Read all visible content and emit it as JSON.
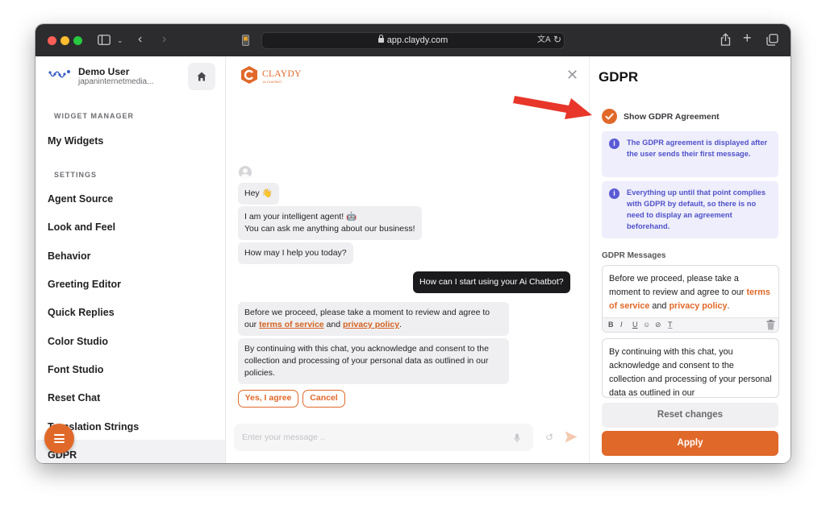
{
  "browser": {
    "url": "app.claydy.com"
  },
  "sidebar": {
    "user_name": "Demo User",
    "user_email": "japaninternetmedia...",
    "section_widget": "WIDGET MANAGER",
    "widget_items": [
      {
        "label": "My Widgets"
      }
    ],
    "section_settings": "SETTINGS",
    "settings_items": [
      {
        "label": "Agent Source"
      },
      {
        "label": "Look and Feel"
      },
      {
        "label": "Behavior"
      },
      {
        "label": "Greeting Editor"
      },
      {
        "label": "Quick Replies"
      },
      {
        "label": "Color Studio"
      },
      {
        "label": "Font Studio"
      },
      {
        "label": "Reset Chat"
      },
      {
        "label": "Translation Strings"
      },
      {
        "label": "GDPR"
      }
    ]
  },
  "chat": {
    "brand_name": "CLAYDY",
    "brand_sub": "AI CHATBOT",
    "messages": [
      {
        "text": "Hey 👋"
      },
      {
        "line1": "I am your intelligent agent! 🤖",
        "line2": "You can ask me anything about our business!"
      },
      {
        "text": "How may I help you today?"
      },
      {
        "text": "How can I start using your Ai Chatbot?"
      },
      {
        "pre": "Before we proceed, please take a moment to review and agree to our ",
        "link1": "terms of service",
        "mid": " and ",
        "link2": "privacy policy",
        "post": "."
      },
      {
        "text": "By continuing with this chat, you acknowledge and consent to the collection and processing of your personal data as outlined in our policies."
      }
    ],
    "agree_label": "Yes, I agree",
    "cancel_label": "Cancel",
    "input_placeholder": "Enter your message .."
  },
  "panel": {
    "title": "GDPR",
    "show_agreement_label": "Show GDPR Agreement",
    "show_agreement_checked": true,
    "info1": "The GDPR agreement is displayed after the user sends their first message.",
    "info2": "Everything up until that point complies with GDPR by default, so there is no need to display an agreement beforehand.",
    "messages_label": "GDPR Messages",
    "message1": {
      "pre": "Before we proceed, please take a moment to review and agree to our ",
      "link1": "terms of service",
      "mid": " and ",
      "link2": "privacy policy",
      "post": "."
    },
    "message2": "By continuing with this chat, you acknowledge and consent to the collection and processing of your personal data as outlined in our",
    "toolbar": {
      "bold": "B",
      "italic": "I",
      "underline": "U",
      "emoji": "☺",
      "link": "⊘",
      "clear": "T̲"
    },
    "reset_label": "Reset changes",
    "apply_label": "Apply"
  },
  "colors": {
    "accent": "#e0692a",
    "info_bg": "#eeeefc",
    "info_text": "#5151c9",
    "annotation_arrow": "#e8362a"
  }
}
